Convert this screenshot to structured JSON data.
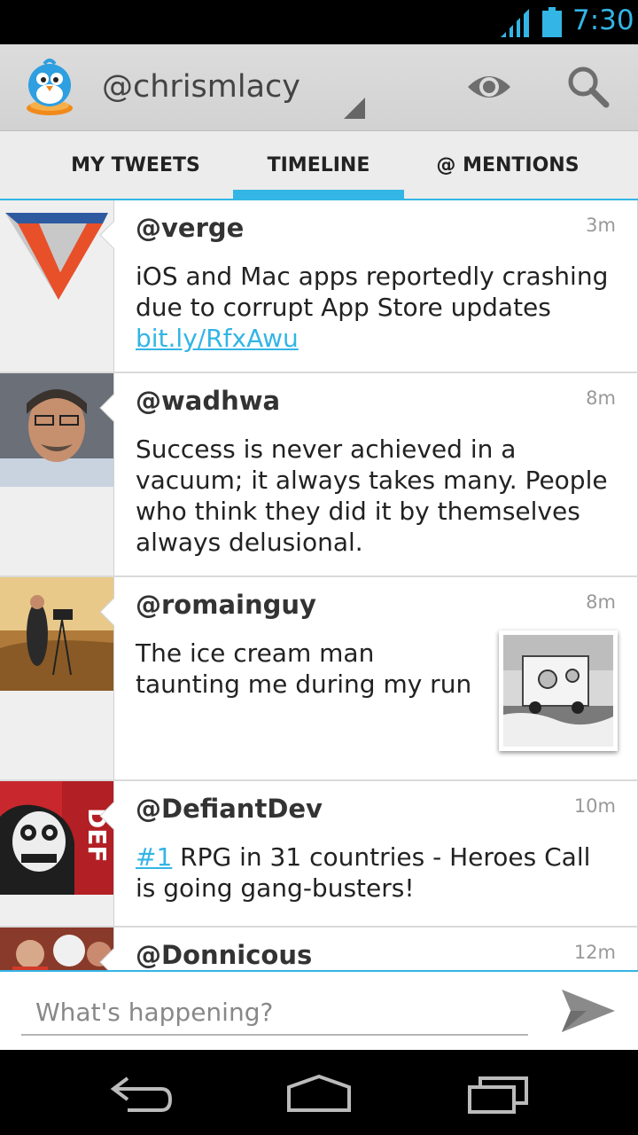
{
  "status_bar": {
    "time": "7:30",
    "accent": "#33b5e5"
  },
  "action_bar": {
    "account": "@chrismlacy",
    "icons": [
      "app-logo",
      "eye-icon",
      "search-icon"
    ]
  },
  "tabs": [
    {
      "label": "MY TWEETS"
    },
    {
      "label": "TIMELINE",
      "selected": true
    },
    {
      "label": "@ MENTIONS"
    }
  ],
  "tweets": [
    {
      "handle": "@verge",
      "time": "3m",
      "text": "iOS and Mac apps reportedly crashing due to corrupt App Store updates ",
      "link": "bit.ly/RfxAwu"
    },
    {
      "handle": "@wadhwa",
      "time": "8m",
      "text": "Success is never achieved in a vacuum; it always takes many. People who think they did it by themselves always delusional."
    },
    {
      "handle": "@romainguy",
      "time": "8m",
      "text": "The ice cream man taunting me during my run",
      "has_photo": true
    },
    {
      "handle": "@DefiantDev",
      "time": "10m",
      "hashtag": "#1",
      "text": " RPG in 31 countries - Heroes Call is going gang-busters!"
    },
    {
      "handle": "@Donnicous",
      "time": "12m"
    }
  ],
  "compose": {
    "placeholder": "What's happening?"
  },
  "nav_bar": {
    "icons": [
      "back-icon",
      "home-icon",
      "recents-icon"
    ]
  }
}
